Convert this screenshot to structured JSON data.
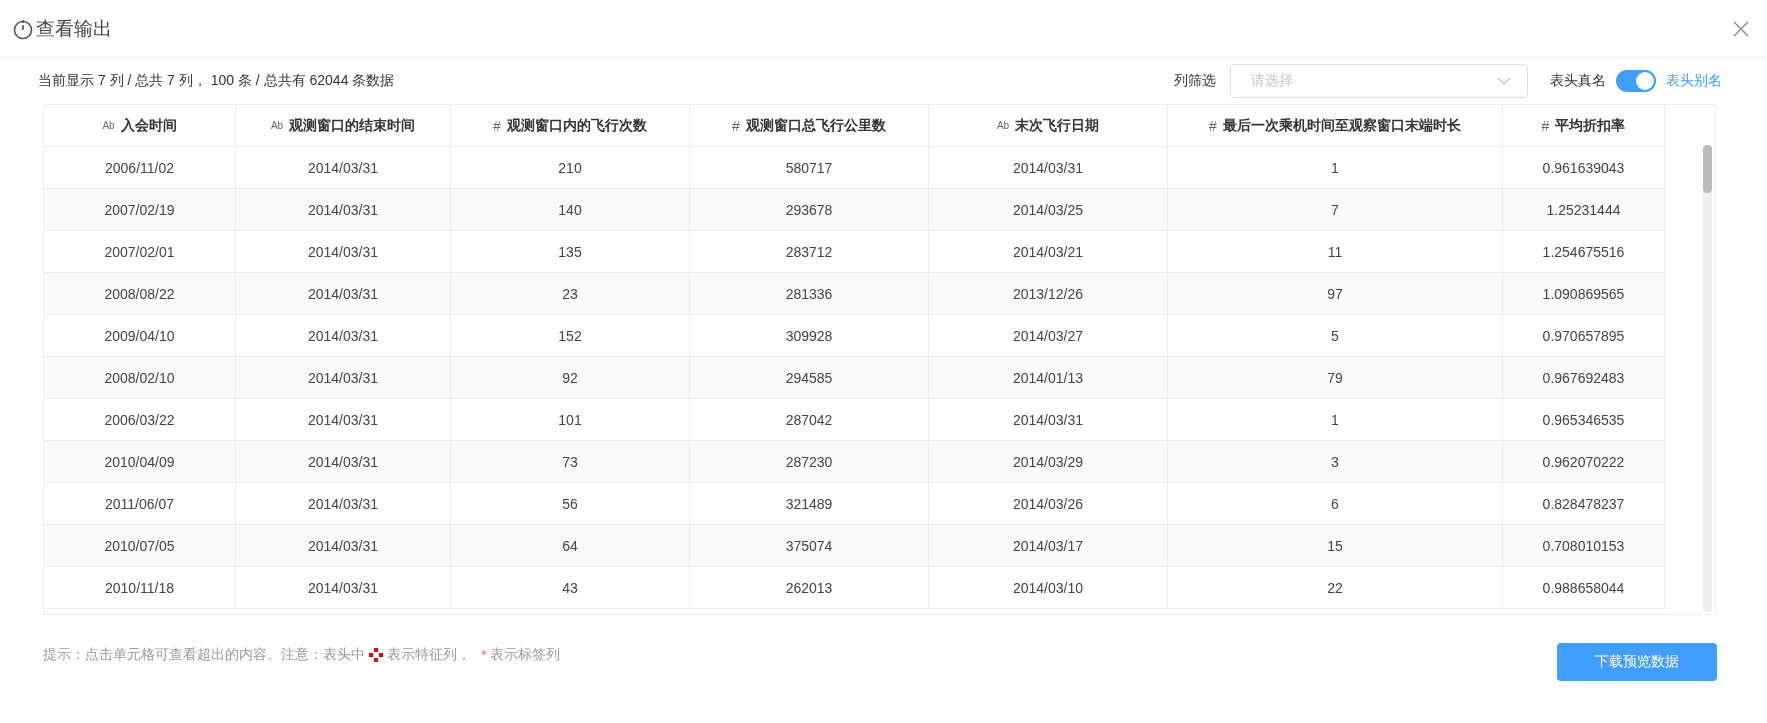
{
  "dialog": {
    "title": "查看输出"
  },
  "summary": "当前显示 7 列 / 总共 7 列， 100 条 / 总共有 62044 条数据",
  "column_filter": {
    "label": "列筛选",
    "placeholder": "请选择"
  },
  "header_toggle": {
    "off_label": "表头真名",
    "on": true,
    "on_label": "表头别名"
  },
  "table": {
    "columns": [
      {
        "kind": "text",
        "icon_text": "Ab",
        "label": "入会时间"
      },
      {
        "kind": "text",
        "icon_text": "Ab",
        "label": "观测窗口的结束时间"
      },
      {
        "kind": "number",
        "icon_text": "#",
        "label": "观测窗口内的飞行次数"
      },
      {
        "kind": "number",
        "icon_text": "#",
        "label": "观测窗口总飞行公里数"
      },
      {
        "kind": "text",
        "icon_text": "Ab",
        "label": "末次飞行日期"
      },
      {
        "kind": "number",
        "icon_text": "#",
        "label": "最后一次乘机时间至观察窗口末端时长"
      },
      {
        "kind": "number",
        "icon_text": "#",
        "label": "平均折扣率"
      }
    ],
    "rows": [
      [
        "2006/11/02",
        "2014/03/31",
        "210",
        "580717",
        "2014/03/31",
        "1",
        "0.961639043"
      ],
      [
        "2007/02/19",
        "2014/03/31",
        "140",
        "293678",
        "2014/03/25",
        "7",
        "1.25231444"
      ],
      [
        "2007/02/01",
        "2014/03/31",
        "135",
        "283712",
        "2014/03/21",
        "11",
        "1.254675516"
      ],
      [
        "2008/08/22",
        "2014/03/31",
        "23",
        "281336",
        "2013/12/26",
        "97",
        "1.090869565"
      ],
      [
        "2009/04/10",
        "2014/03/31",
        "152",
        "309928",
        "2014/03/27",
        "5",
        "0.970657895"
      ],
      [
        "2008/02/10",
        "2014/03/31",
        "92",
        "294585",
        "2014/01/13",
        "79",
        "0.967692483"
      ],
      [
        "2006/03/22",
        "2014/03/31",
        "101",
        "287042",
        "2014/03/31",
        "1",
        "0.965346535"
      ],
      [
        "2010/04/09",
        "2014/03/31",
        "73",
        "287230",
        "2014/03/29",
        "3",
        "0.962070222"
      ],
      [
        "2011/06/07",
        "2014/03/31",
        "56",
        "321489",
        "2014/03/26",
        "6",
        "0.828478237"
      ],
      [
        "2010/07/05",
        "2014/03/31",
        "64",
        "375074",
        "2014/03/17",
        "15",
        "0.708010153"
      ],
      [
        "2010/11/18",
        "2014/03/31",
        "43",
        "262013",
        "2014/03/10",
        "22",
        "0.988658044"
      ]
    ]
  },
  "hint": {
    "prefix": "提示：点击单元格可查看超出的内容。注意：表头中",
    "feature_suffix": "表示特征列，",
    "label_mark": "*",
    "label_suffix": "表示标签列"
  },
  "download_button": "下载预览数据"
}
